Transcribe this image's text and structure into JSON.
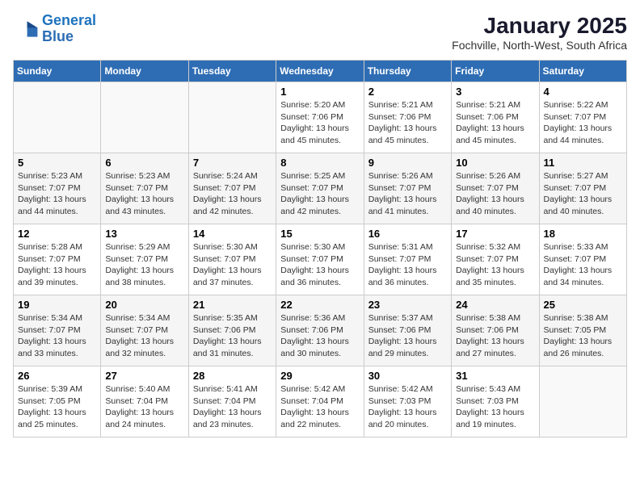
{
  "logo": {
    "line1": "General",
    "line2": "Blue"
  },
  "title": "January 2025",
  "subtitle": "Fochville, North-West, South Africa",
  "days_of_week": [
    "Sunday",
    "Monday",
    "Tuesday",
    "Wednesday",
    "Thursday",
    "Friday",
    "Saturday"
  ],
  "weeks": [
    [
      {
        "day": "",
        "info": ""
      },
      {
        "day": "",
        "info": ""
      },
      {
        "day": "",
        "info": ""
      },
      {
        "day": "1",
        "info": "Sunrise: 5:20 AM\nSunset: 7:06 PM\nDaylight: 13 hours\nand 45 minutes."
      },
      {
        "day": "2",
        "info": "Sunrise: 5:21 AM\nSunset: 7:06 PM\nDaylight: 13 hours\nand 45 minutes."
      },
      {
        "day": "3",
        "info": "Sunrise: 5:21 AM\nSunset: 7:06 PM\nDaylight: 13 hours\nand 45 minutes."
      },
      {
        "day": "4",
        "info": "Sunrise: 5:22 AM\nSunset: 7:07 PM\nDaylight: 13 hours\nand 44 minutes."
      }
    ],
    [
      {
        "day": "5",
        "info": "Sunrise: 5:23 AM\nSunset: 7:07 PM\nDaylight: 13 hours\nand 44 minutes."
      },
      {
        "day": "6",
        "info": "Sunrise: 5:23 AM\nSunset: 7:07 PM\nDaylight: 13 hours\nand 43 minutes."
      },
      {
        "day": "7",
        "info": "Sunrise: 5:24 AM\nSunset: 7:07 PM\nDaylight: 13 hours\nand 42 minutes."
      },
      {
        "day": "8",
        "info": "Sunrise: 5:25 AM\nSunset: 7:07 PM\nDaylight: 13 hours\nand 42 minutes."
      },
      {
        "day": "9",
        "info": "Sunrise: 5:26 AM\nSunset: 7:07 PM\nDaylight: 13 hours\nand 41 minutes."
      },
      {
        "day": "10",
        "info": "Sunrise: 5:26 AM\nSunset: 7:07 PM\nDaylight: 13 hours\nand 40 minutes."
      },
      {
        "day": "11",
        "info": "Sunrise: 5:27 AM\nSunset: 7:07 PM\nDaylight: 13 hours\nand 40 minutes."
      }
    ],
    [
      {
        "day": "12",
        "info": "Sunrise: 5:28 AM\nSunset: 7:07 PM\nDaylight: 13 hours\nand 39 minutes."
      },
      {
        "day": "13",
        "info": "Sunrise: 5:29 AM\nSunset: 7:07 PM\nDaylight: 13 hours\nand 38 minutes."
      },
      {
        "day": "14",
        "info": "Sunrise: 5:30 AM\nSunset: 7:07 PM\nDaylight: 13 hours\nand 37 minutes."
      },
      {
        "day": "15",
        "info": "Sunrise: 5:30 AM\nSunset: 7:07 PM\nDaylight: 13 hours\nand 36 minutes."
      },
      {
        "day": "16",
        "info": "Sunrise: 5:31 AM\nSunset: 7:07 PM\nDaylight: 13 hours\nand 36 minutes."
      },
      {
        "day": "17",
        "info": "Sunrise: 5:32 AM\nSunset: 7:07 PM\nDaylight: 13 hours\nand 35 minutes."
      },
      {
        "day": "18",
        "info": "Sunrise: 5:33 AM\nSunset: 7:07 PM\nDaylight: 13 hours\nand 34 minutes."
      }
    ],
    [
      {
        "day": "19",
        "info": "Sunrise: 5:34 AM\nSunset: 7:07 PM\nDaylight: 13 hours\nand 33 minutes."
      },
      {
        "day": "20",
        "info": "Sunrise: 5:34 AM\nSunset: 7:07 PM\nDaylight: 13 hours\nand 32 minutes."
      },
      {
        "day": "21",
        "info": "Sunrise: 5:35 AM\nSunset: 7:06 PM\nDaylight: 13 hours\nand 31 minutes."
      },
      {
        "day": "22",
        "info": "Sunrise: 5:36 AM\nSunset: 7:06 PM\nDaylight: 13 hours\nand 30 minutes."
      },
      {
        "day": "23",
        "info": "Sunrise: 5:37 AM\nSunset: 7:06 PM\nDaylight: 13 hours\nand 29 minutes."
      },
      {
        "day": "24",
        "info": "Sunrise: 5:38 AM\nSunset: 7:06 PM\nDaylight: 13 hours\nand 27 minutes."
      },
      {
        "day": "25",
        "info": "Sunrise: 5:38 AM\nSunset: 7:05 PM\nDaylight: 13 hours\nand 26 minutes."
      }
    ],
    [
      {
        "day": "26",
        "info": "Sunrise: 5:39 AM\nSunset: 7:05 PM\nDaylight: 13 hours\nand 25 minutes."
      },
      {
        "day": "27",
        "info": "Sunrise: 5:40 AM\nSunset: 7:04 PM\nDaylight: 13 hours\nand 24 minutes."
      },
      {
        "day": "28",
        "info": "Sunrise: 5:41 AM\nSunset: 7:04 PM\nDaylight: 13 hours\nand 23 minutes."
      },
      {
        "day": "29",
        "info": "Sunrise: 5:42 AM\nSunset: 7:04 PM\nDaylight: 13 hours\nand 22 minutes."
      },
      {
        "day": "30",
        "info": "Sunrise: 5:42 AM\nSunset: 7:03 PM\nDaylight: 13 hours\nand 20 minutes."
      },
      {
        "day": "31",
        "info": "Sunrise: 5:43 AM\nSunset: 7:03 PM\nDaylight: 13 hours\nand 19 minutes."
      },
      {
        "day": "",
        "info": ""
      }
    ]
  ]
}
